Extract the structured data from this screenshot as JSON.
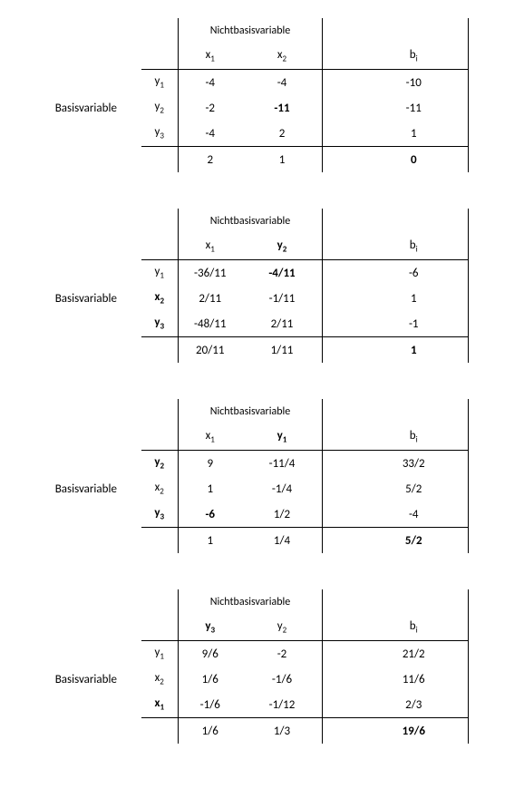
{
  "labels": {
    "basis": "Basisvariable",
    "nonbasis": "Nichtbasisvariable"
  },
  "tableaus": [
    {
      "nb_cols": [
        {
          "text": "x",
          "sub": "1",
          "bold": false
        },
        {
          "text": "x",
          "sub": "2",
          "bold": false
        }
      ],
      "b_col": {
        "text": "b",
        "sub": "i",
        "bold": false
      },
      "rows": [
        {
          "label": {
            "text": "y",
            "sub": "1",
            "bold": false
          },
          "c1": {
            "v": "-4"
          },
          "c2": {
            "v": "-4"
          },
          "b": {
            "v": "-10"
          }
        },
        {
          "label": {
            "text": "y",
            "sub": "2",
            "bold": false
          },
          "c1": {
            "v": "-2"
          },
          "c2": {
            "v": "-11",
            "bold": true
          },
          "b": {
            "v": "-11"
          }
        },
        {
          "label": {
            "text": "y",
            "sub": "3",
            "bold": false
          },
          "c1": {
            "v": "-4"
          },
          "c2": {
            "v": "2"
          },
          "b": {
            "v": "1"
          }
        }
      ],
      "obj": {
        "c1": {
          "v": "2"
        },
        "c2": {
          "v": "1"
        },
        "b": {
          "v": "0",
          "bold": true
        }
      }
    },
    {
      "nb_cols": [
        {
          "text": "x",
          "sub": "1",
          "bold": false
        },
        {
          "text": "y",
          "sub": "2",
          "bold": true
        }
      ],
      "b_col": {
        "text": "b",
        "sub": "i",
        "bold": false
      },
      "rows": [
        {
          "label": {
            "text": "y",
            "sub": "1",
            "bold": false
          },
          "c1": {
            "v": "-36/11"
          },
          "c2": {
            "v": "-4/11",
            "bold": true
          },
          "b": {
            "v": "-6"
          }
        },
        {
          "label": {
            "text": "x",
            "sub": "2",
            "bold": true
          },
          "c1": {
            "v": "2/11"
          },
          "c2": {
            "v": "-1/11"
          },
          "b": {
            "v": "1"
          }
        },
        {
          "label": {
            "text": "y",
            "sub": "3",
            "bold": true
          },
          "c1": {
            "v": "-48/11"
          },
          "c2": {
            "v": "2/11"
          },
          "b": {
            "v": "-1"
          }
        }
      ],
      "obj": {
        "c1": {
          "v": "20/11"
        },
        "c2": {
          "v": "1/11"
        },
        "b": {
          "v": "1",
          "bold": true
        }
      }
    },
    {
      "nb_cols": [
        {
          "text": "x",
          "sub": "1",
          "bold": false
        },
        {
          "text": "y",
          "sub": "1",
          "bold": true
        }
      ],
      "b_col": {
        "text": "b",
        "sub": "i",
        "bold": false
      },
      "rows": [
        {
          "label": {
            "text": "y",
            "sub": "2",
            "bold": true
          },
          "c1": {
            "v": "9"
          },
          "c2": {
            "v": "-11/4"
          },
          "b": {
            "v": "33/2"
          }
        },
        {
          "label": {
            "text": "x",
            "sub": "2",
            "bold": false
          },
          "c1": {
            "v": "1"
          },
          "c2": {
            "v": "-1/4"
          },
          "b": {
            "v": "5/2"
          }
        },
        {
          "label": {
            "text": "y",
            "sub": "3",
            "bold": true
          },
          "c1": {
            "v": "-6",
            "bold": true
          },
          "c2": {
            "v": "1/2"
          },
          "b": {
            "v": "-4"
          }
        }
      ],
      "obj": {
        "c1": {
          "v": "1"
        },
        "c2": {
          "v": "1/4"
        },
        "b": {
          "v": "5/2",
          "bold": true
        }
      }
    },
    {
      "nb_cols": [
        {
          "text": "y",
          "sub": "3",
          "bold": true
        },
        {
          "text": "y",
          "sub": "2",
          "bold": false
        }
      ],
      "b_col": {
        "text": "b",
        "sub": "i",
        "bold": false
      },
      "rows": [
        {
          "label": {
            "text": "y",
            "sub": "1",
            "bold": false
          },
          "c1": {
            "v": "9/6"
          },
          "c2": {
            "v": "-2"
          },
          "b": {
            "v": "21/2"
          }
        },
        {
          "label": {
            "text": "x",
            "sub": "2",
            "bold": false
          },
          "c1": {
            "v": "1/6"
          },
          "c2": {
            "v": "-1/6"
          },
          "b": {
            "v": "11/6"
          }
        },
        {
          "label": {
            "text": "x",
            "sub": "1",
            "bold": true
          },
          "c1": {
            "v": "-1/6"
          },
          "c2": {
            "v": "-1/12"
          },
          "b": {
            "v": "2/3"
          }
        }
      ],
      "obj": {
        "c1": {
          "v": "1/6"
        },
        "c2": {
          "v": "1/3"
        },
        "b": {
          "v": "19/6",
          "bold": true
        }
      }
    }
  ],
  "chart_data": {
    "type": "table",
    "description": "Simplex method tableaus (4 iterations)",
    "tableaus": [
      {
        "basis_vars": [
          "y1",
          "y2",
          "y3"
        ],
        "nonbasis_vars": [
          "x1",
          "x2"
        ],
        "matrix": [
          [
            -4,
            -4,
            -10
          ],
          [
            -2,
            -11,
            -11
          ],
          [
            -4,
            2,
            1
          ]
        ],
        "objective": [
          2,
          1,
          0
        ],
        "pivot": {
          "row": "y2",
          "col": "x2",
          "value": -11
        }
      },
      {
        "basis_vars": [
          "y1",
          "x2",
          "y3"
        ],
        "nonbasis_vars": [
          "x1",
          "y2"
        ],
        "matrix": [
          [
            "-36/11",
            "-4/11",
            -6
          ],
          [
            "2/11",
            "-1/11",
            1
          ],
          [
            "-48/11",
            "2/11",
            -1
          ]
        ],
        "objective": [
          "20/11",
          "1/11",
          1
        ],
        "pivot": {
          "row": "y1",
          "col": "y2",
          "value": "-4/11"
        }
      },
      {
        "basis_vars": [
          "y2",
          "x2",
          "y3"
        ],
        "nonbasis_vars": [
          "x1",
          "y1"
        ],
        "matrix": [
          [
            9,
            "-11/4",
            "33/2"
          ],
          [
            1,
            "-1/4",
            "5/2"
          ],
          [
            -6,
            "1/2",
            -4
          ]
        ],
        "objective": [
          1,
          "1/4",
          "5/2"
        ],
        "pivot": {
          "row": "y3",
          "col": "x1",
          "value": -6
        }
      },
      {
        "basis_vars": [
          "y1",
          "x2",
          "x1"
        ],
        "nonbasis_vars": [
          "y3",
          "y2"
        ],
        "matrix": [
          [
            "9/6",
            -2,
            "21/2"
          ],
          [
            "1/6",
            "-1/6",
            "11/6"
          ],
          [
            "-1/6",
            "-1/12",
            "2/3"
          ]
        ],
        "objective": [
          "1/6",
          "1/3",
          "19/6"
        ]
      }
    ]
  }
}
